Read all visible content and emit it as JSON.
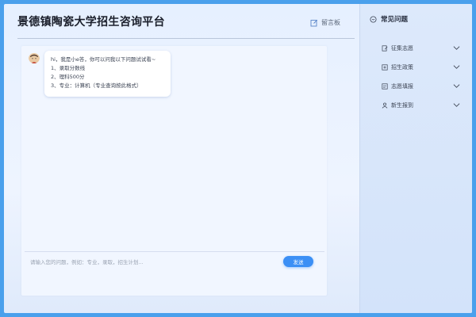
{
  "header": {
    "title": "景德镇陶瓷大学招生咨询平台",
    "board_label": "留言板"
  },
  "chat": {
    "messages": [
      {
        "sender": "bot",
        "lines": [
          "hi，我是小e答，你可以问我以下问题试试看~",
          "1、录取分数线",
          "2、理科500分",
          "3、专业：计算机（专业查询按此格式）"
        ]
      }
    ],
    "input": {
      "value": "",
      "placeholder": "请输入您的问题，例如：专业，录取，招生计划..."
    },
    "send_label": "发送"
  },
  "sidebar": {
    "heading": "常见问题",
    "items": [
      {
        "label": "征集志愿",
        "icon": "edit-doc-icon"
      },
      {
        "label": "招生政策",
        "icon": "policy-icon"
      },
      {
        "label": "志愿填报",
        "icon": "fill-form-icon"
      },
      {
        "label": "新生报到",
        "icon": "user-icon"
      }
    ]
  },
  "colors": {
    "accent": "#3b8ff5",
    "border": "#4aa0ec",
    "panel": "#f1f6ff",
    "sidebar": "#d9e6fa"
  }
}
